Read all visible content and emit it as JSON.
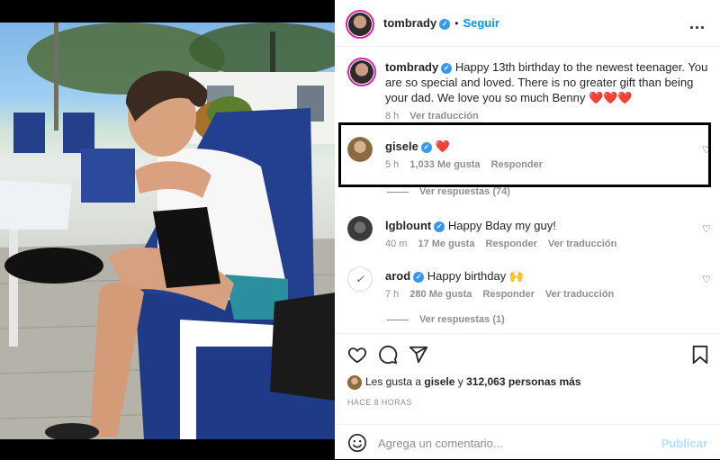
{
  "post": {
    "author": "tombrady",
    "follow_label": "Seguir",
    "separator": "•",
    "more": "...",
    "caption_author": "tombrady",
    "caption_text": "Happy 13th birthday to the newest teenager. You are so special and loved. There is no greater gift than being your dad. We love you so much Benny ❤️❤️❤️",
    "caption_time": "8 h",
    "caption_translate": "Ver traducción"
  },
  "comments": [
    {
      "user": "gisele",
      "text": "❤️",
      "time": "5 h",
      "likes": "1,033 Me gusta",
      "reply": "Responder",
      "translate": "",
      "view_replies": "Ver respuestas (74)"
    },
    {
      "user": "lgblount",
      "text": "Happy Bday my guy!",
      "time": "40 m",
      "likes": "17 Me gusta",
      "reply": "Responder",
      "translate": "Ver traducción",
      "view_replies": ""
    },
    {
      "user": "arod",
      "text": "Happy birthday 🙌",
      "time": "7 h",
      "likes": "280 Me gusta",
      "reply": "Responder",
      "translate": "Ver traducción",
      "view_replies": "Ver respuestas (1)"
    }
  ],
  "likes_summary": {
    "prefix": "Les gusta a",
    "user": "gisele",
    "middle": "y",
    "count": "312,063 personas más"
  },
  "timestamp": "HACE 8 HORAS",
  "composer": {
    "placeholder": "Agrega un comentario...",
    "publish": "Publicar"
  },
  "icons": {
    "like": "heart-outline-icon",
    "comment": "speech-bubble-icon",
    "share": "paper-plane-icon",
    "save": "bookmark-icon",
    "emoji": "smiley-icon",
    "verified": "verified-badge-icon"
  },
  "colors": {
    "accent": "#0095f6",
    "verified": "#3897f0",
    "muted": "#8e8e8e",
    "highlight_border": "#000000"
  }
}
